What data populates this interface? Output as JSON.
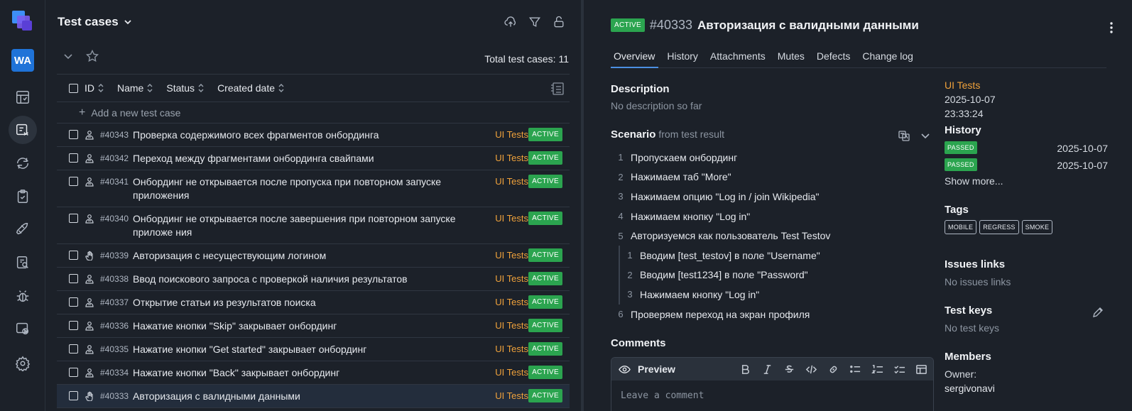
{
  "rail": {
    "workspace_initials": "WA"
  },
  "list": {
    "title": "Test cases",
    "total_label": "Total test cases: 11",
    "columns": [
      "ID",
      "Name",
      "Status",
      "Created date"
    ],
    "add_label": "Add a new test case",
    "rows": [
      {
        "id": "#40343",
        "name": "Проверка содержимого всех фрагментов онбординга",
        "layer": "UI Tests",
        "status": "ACTIVE",
        "type": "automated"
      },
      {
        "id": "#40342",
        "name": "Переход между фрагментами онбординга свайпами",
        "layer": "UI Tests",
        "status": "ACTIVE",
        "type": "automated"
      },
      {
        "id": "#40341",
        "name": "Онбординг не открывается после пропуска при повторном запуске приложения",
        "layer": "UI Tests",
        "status": "ACTIVE",
        "type": "automated"
      },
      {
        "id": "#40340",
        "name": "Онбординг не открывается после завершения при повторном запуске приложе ния",
        "layer": "UI Tests",
        "status": "ACTIVE",
        "type": "automated"
      },
      {
        "id": "#40339",
        "name": "Авторизация с несуществующим логином",
        "layer": "UI Tests",
        "status": "ACTIVE",
        "type": "manual"
      },
      {
        "id": "#40338",
        "name": "Ввод поискового запроса с проверкой наличия результатов",
        "layer": "UI Tests",
        "status": "ACTIVE",
        "type": "automated"
      },
      {
        "id": "#40337",
        "name": "Открытие статьи из результатов поиска",
        "layer": "UI Tests",
        "status": "ACTIVE",
        "type": "automated"
      },
      {
        "id": "#40336",
        "name": "Нажатие кнопки \"Skip\" закрывает онбординг",
        "layer": "UI Tests",
        "status": "ACTIVE",
        "type": "automated"
      },
      {
        "id": "#40335",
        "name": "Нажатие кнопки \"Get started\" закрывает онбординг",
        "layer": "UI Tests",
        "status": "ACTIVE",
        "type": "automated"
      },
      {
        "id": "#40334",
        "name": "Нажатие кнопки \"Back\" закрывает онбординг",
        "layer": "UI Tests",
        "status": "ACTIVE",
        "type": "automated"
      },
      {
        "id": "#40333",
        "name": "Авторизация с валидными данными",
        "layer": "UI Tests",
        "status": "ACTIVE",
        "type": "manual",
        "selected": true
      }
    ]
  },
  "detail": {
    "status": "ACTIVE",
    "id": "#40333",
    "title": "Авторизация с валидными данными",
    "tabs": [
      "Overview",
      "History",
      "Attachments",
      "Mutes",
      "Defects",
      "Change log"
    ],
    "description_title": "Description",
    "description_text": "No description so far",
    "scenario_title": "Scenario",
    "scenario_source": "from test result",
    "steps": [
      {
        "num": "1",
        "text": "Пропускаем онбординг"
      },
      {
        "num": "2",
        "text": "Нажимаем таб \"More\""
      },
      {
        "num": "3",
        "text": "Нажимаем опцию \"Log in / join Wikipedia\""
      },
      {
        "num": "4",
        "text": "Нажимаем кнопку \"Log in\""
      },
      {
        "num": "5",
        "text": "Авторизуемся как пользователь Test Testov"
      }
    ],
    "substeps": [
      {
        "num": "1",
        "text": "Вводим [test_testov] в поле \"Username\""
      },
      {
        "num": "2",
        "text": "Вводим [test1234] в поле \"Password\""
      },
      {
        "num": "3",
        "text": "Нажимаем кнопку \"Log in\""
      }
    ],
    "last_step": {
      "num": "6",
      "text": "Проверяем переход на экран профиля"
    },
    "comments_title": "Comments",
    "preview_label": "Preview",
    "comment_placeholder": "Leave a comment",
    "side": {
      "layer": "UI Tests",
      "created_date": "2025-10-07",
      "created_time": "23:33:24",
      "history_title": "History",
      "history": [
        {
          "status": "PASSED",
          "date": "2025-10-07"
        },
        {
          "status": "PASSED",
          "date": "2025-10-07"
        }
      ],
      "show_more": "Show more...",
      "tags_title": "Tags",
      "tags": [
        "MOBILE",
        "REGRESS",
        "SMOKE"
      ],
      "issues_title": "Issues links",
      "issues_text": "No issues links",
      "keys_title": "Test keys",
      "keys_text": "No test keys",
      "members_title": "Members",
      "owner_label": "Owner:",
      "owner_value": "sergivonavi"
    }
  },
  "colors": {
    "background": "#1c2129",
    "active_badge": "#2ba44f",
    "layer": "#f0a23b",
    "tab_accent": "#4b8fe2"
  }
}
